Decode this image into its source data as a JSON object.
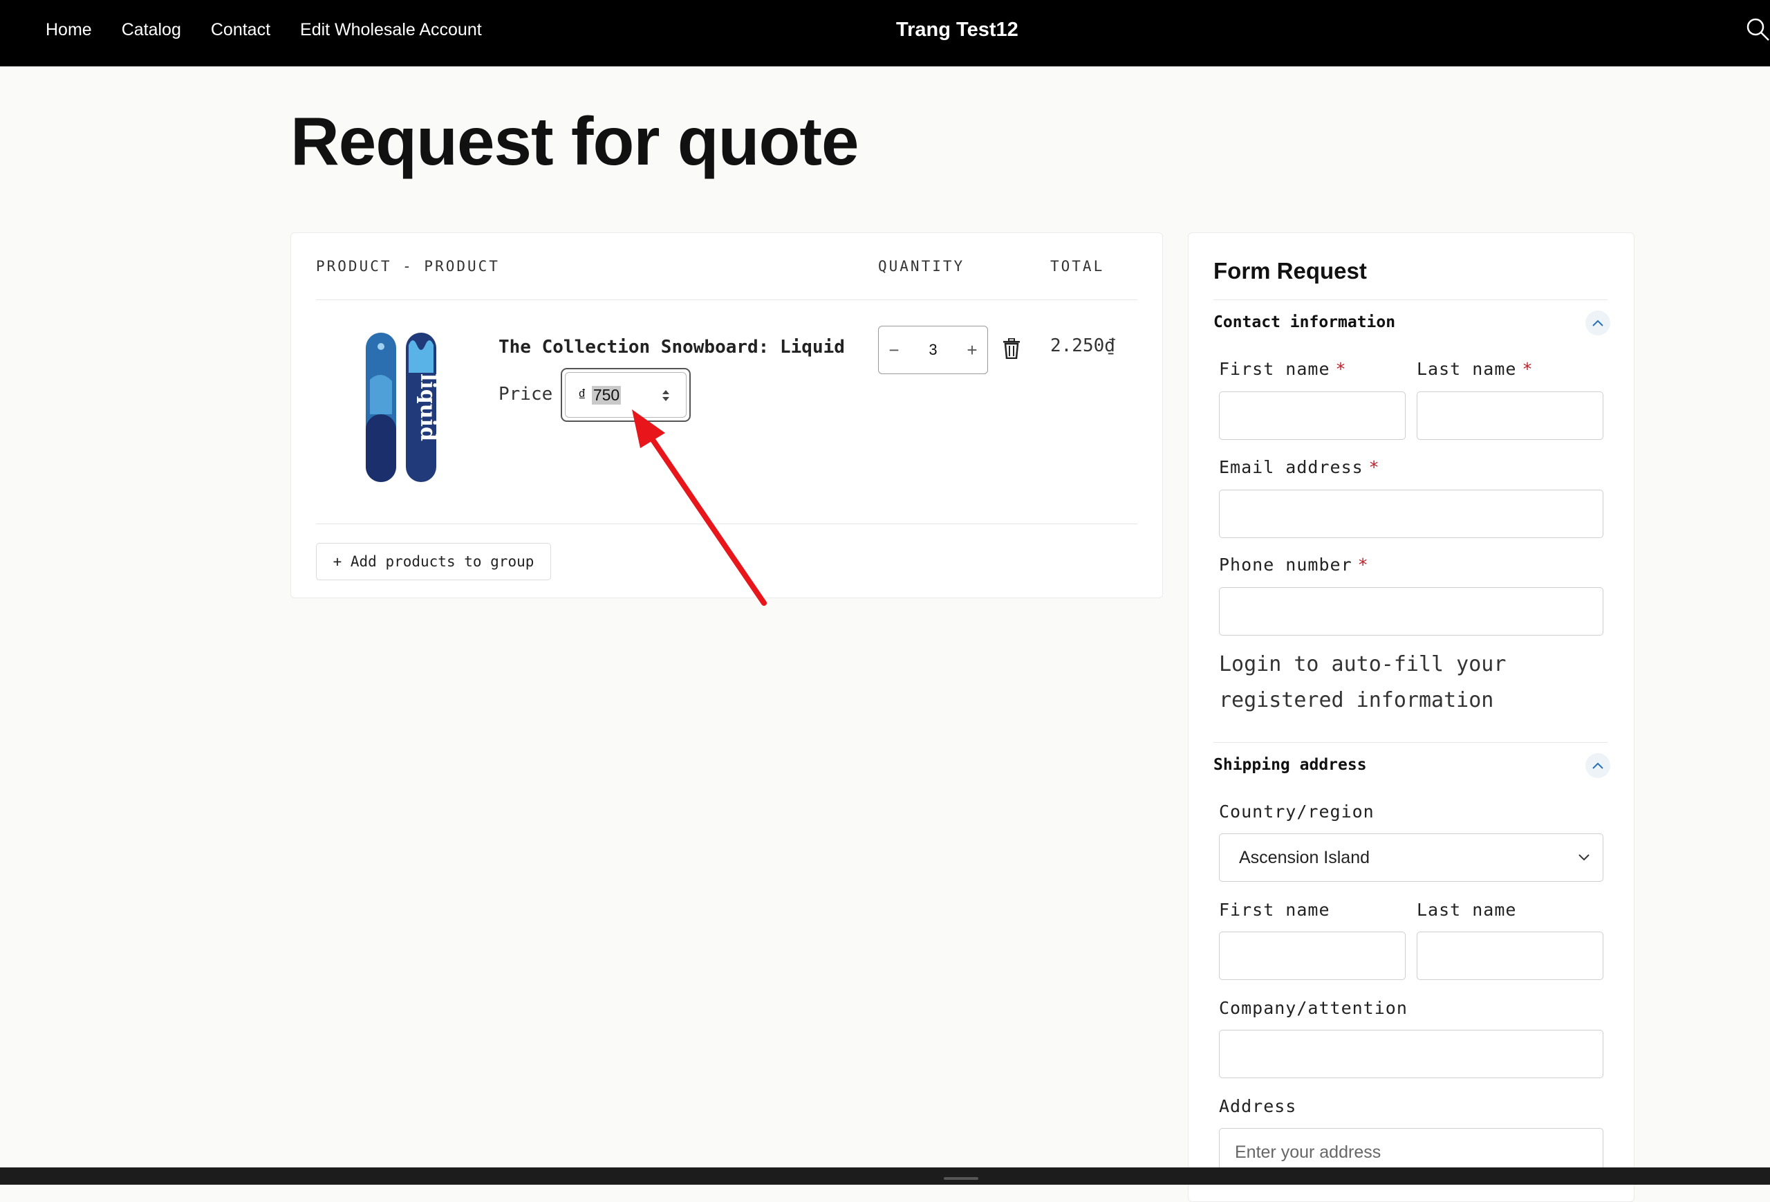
{
  "header": {
    "nav": [
      "Home",
      "Catalog",
      "Contact",
      "Edit Wholesale Account"
    ],
    "brand": "Trang Test12"
  },
  "page": {
    "title": "Request for quote"
  },
  "cart": {
    "headers": {
      "product": "PRODUCT - PRODUCT",
      "quantity": "QUANTITY",
      "total": "TOTAL"
    },
    "item": {
      "name": "The Collection Snowboard: Liquid",
      "price_label": "Price",
      "currency": "₫",
      "price": "750",
      "quantity": "3",
      "total": "2.250₫"
    },
    "add_button": "+ Add products to group"
  },
  "form": {
    "title": "Form Request",
    "contact": {
      "title": "Contact information",
      "first_name": "First name",
      "last_name": "Last name",
      "email": "Email address",
      "phone": "Phone number",
      "required_mark": "*",
      "login_note": "Login to auto-fill your registered information"
    },
    "shipping": {
      "title": "Shipping address",
      "country_label": "Country/region",
      "country_value": "Ascension Island",
      "first_name": "First name",
      "last_name": "Last name",
      "company": "Company/attention",
      "address": "Address",
      "address_placeholder": "Enter your address"
    }
  },
  "colors": {
    "required": "#c0202a",
    "annotation": "#e8161b",
    "header_bg": "#000000"
  }
}
